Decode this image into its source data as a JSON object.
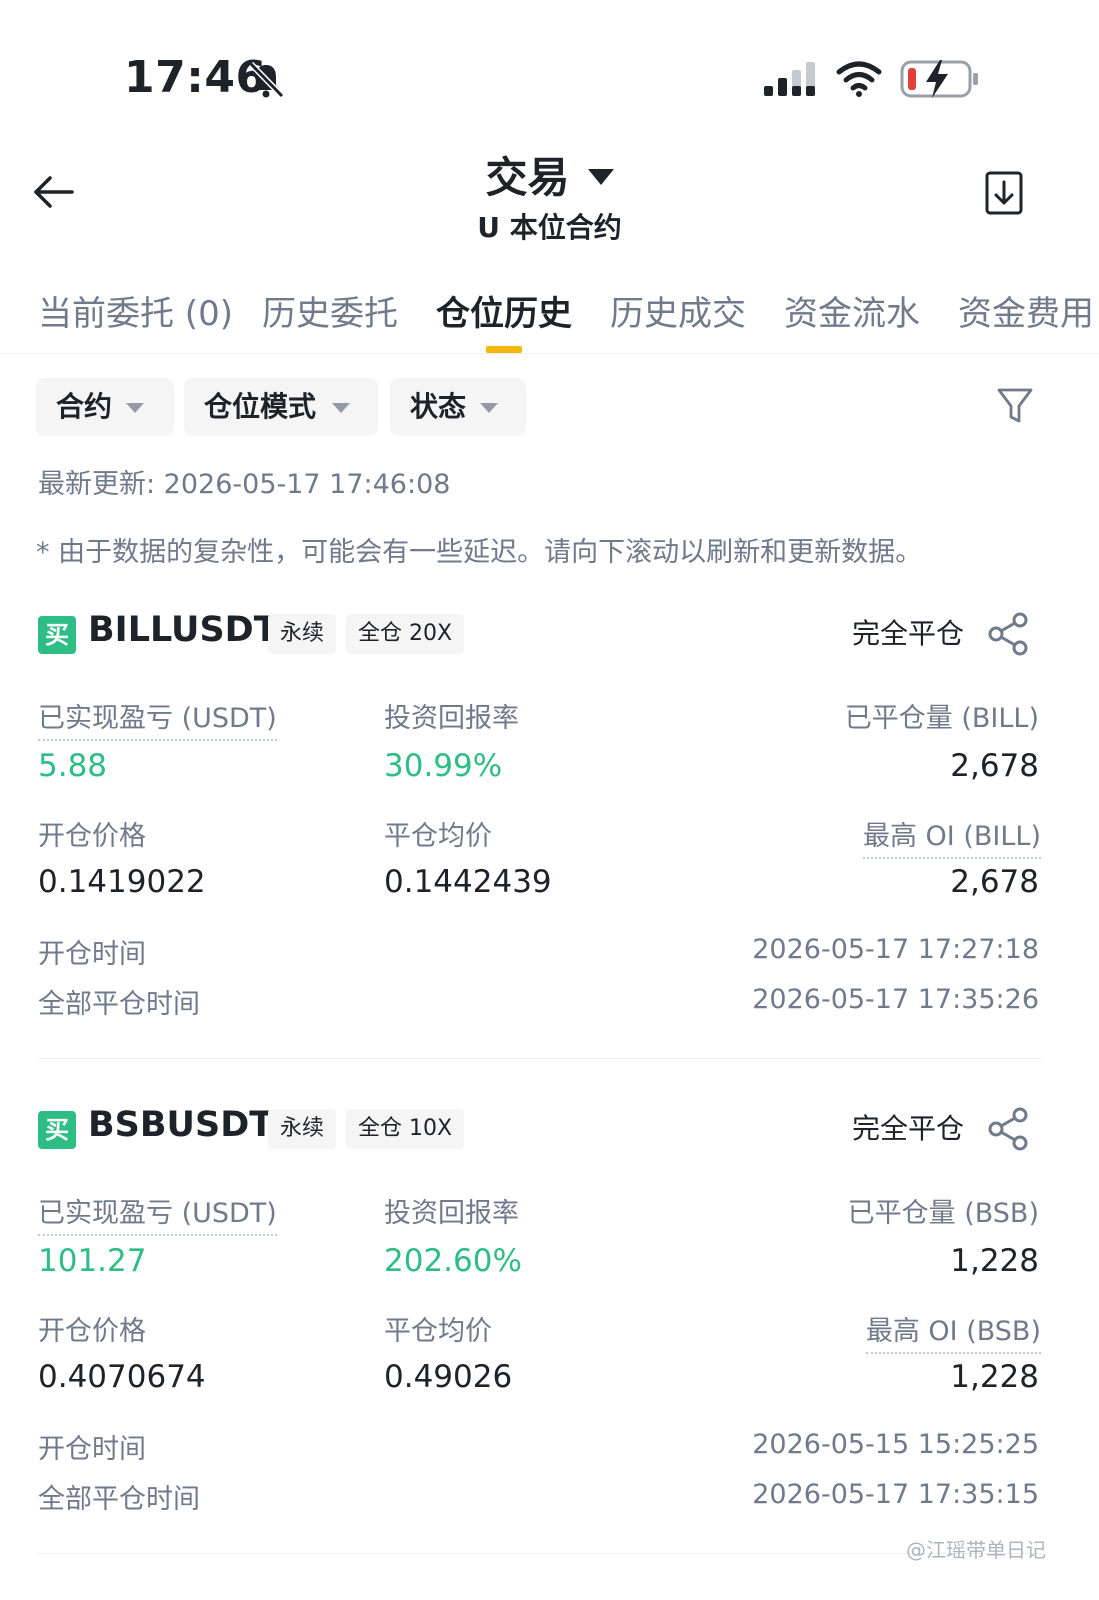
{
  "status": {
    "time": "17:46"
  },
  "header": {
    "title": "交易",
    "subtitle": "U 本位合约"
  },
  "tabs": [
    {
      "label": "当前委托 (0)"
    },
    {
      "label": "历史委托"
    },
    {
      "label": "仓位历史"
    },
    {
      "label": "历史成交"
    },
    {
      "label": "资金流水"
    },
    {
      "label": "资金费用"
    }
  ],
  "filters": [
    {
      "label": "合约"
    },
    {
      "label": "仓位模式"
    },
    {
      "label": "状态"
    }
  ],
  "updated": "最新更新: 2026-05-17 17:46:08",
  "notice": "* 由于数据的复杂性，可能会有一些延迟。请向下滚动以刷新和更新数据。",
  "positions": [
    {
      "side": "买",
      "symbol": "BILLUSDT",
      "type_tag": "永续",
      "margin_tag": "全仓 20X",
      "status": "完全平仓",
      "pnl_label": "已实现盈亏 (USDT)",
      "pnl": "5.88",
      "roi_label": "投资回报率",
      "roi": "30.99%",
      "closed_qty_label": "已平仓量 (BILL)",
      "closed_qty": "2,678",
      "entry_label": "开仓价格",
      "entry": "0.1419022",
      "close_avg_label": "平仓均价",
      "close_avg": "0.1442439",
      "max_oi_label": "最高 OI (BILL)",
      "max_oi": "2,678",
      "open_time_label": "开仓时间",
      "open_time": "2026-05-17 17:27:18",
      "close_time_label": "全部平仓时间",
      "close_time": "2026-05-17 17:35:26"
    },
    {
      "side": "买",
      "symbol": "BSBUSDT",
      "type_tag": "永续",
      "margin_tag": "全仓 10X",
      "status": "完全平仓",
      "pnl_label": "已实现盈亏 (USDT)",
      "pnl": "101.27",
      "roi_label": "投资回报率",
      "roi": "202.60%",
      "closed_qty_label": "已平仓量 (BSB)",
      "closed_qty": "1,228",
      "entry_label": "开仓价格",
      "entry": "0.4070674",
      "close_avg_label": "平仓均价",
      "close_avg": "0.49026",
      "max_oi_label": "最高 OI (BSB)",
      "max_oi": "1,228",
      "open_time_label": "开仓时间",
      "open_time": "2026-05-15 15:25:25",
      "close_time_label": "全部平仓时间",
      "close_time": "2026-05-17 17:35:15"
    }
  ],
  "watermark": "@江瑶带单日记",
  "colors": {
    "profit": "#2ebd85",
    "accent": "#f0b90b",
    "muted": "#707a8a"
  }
}
